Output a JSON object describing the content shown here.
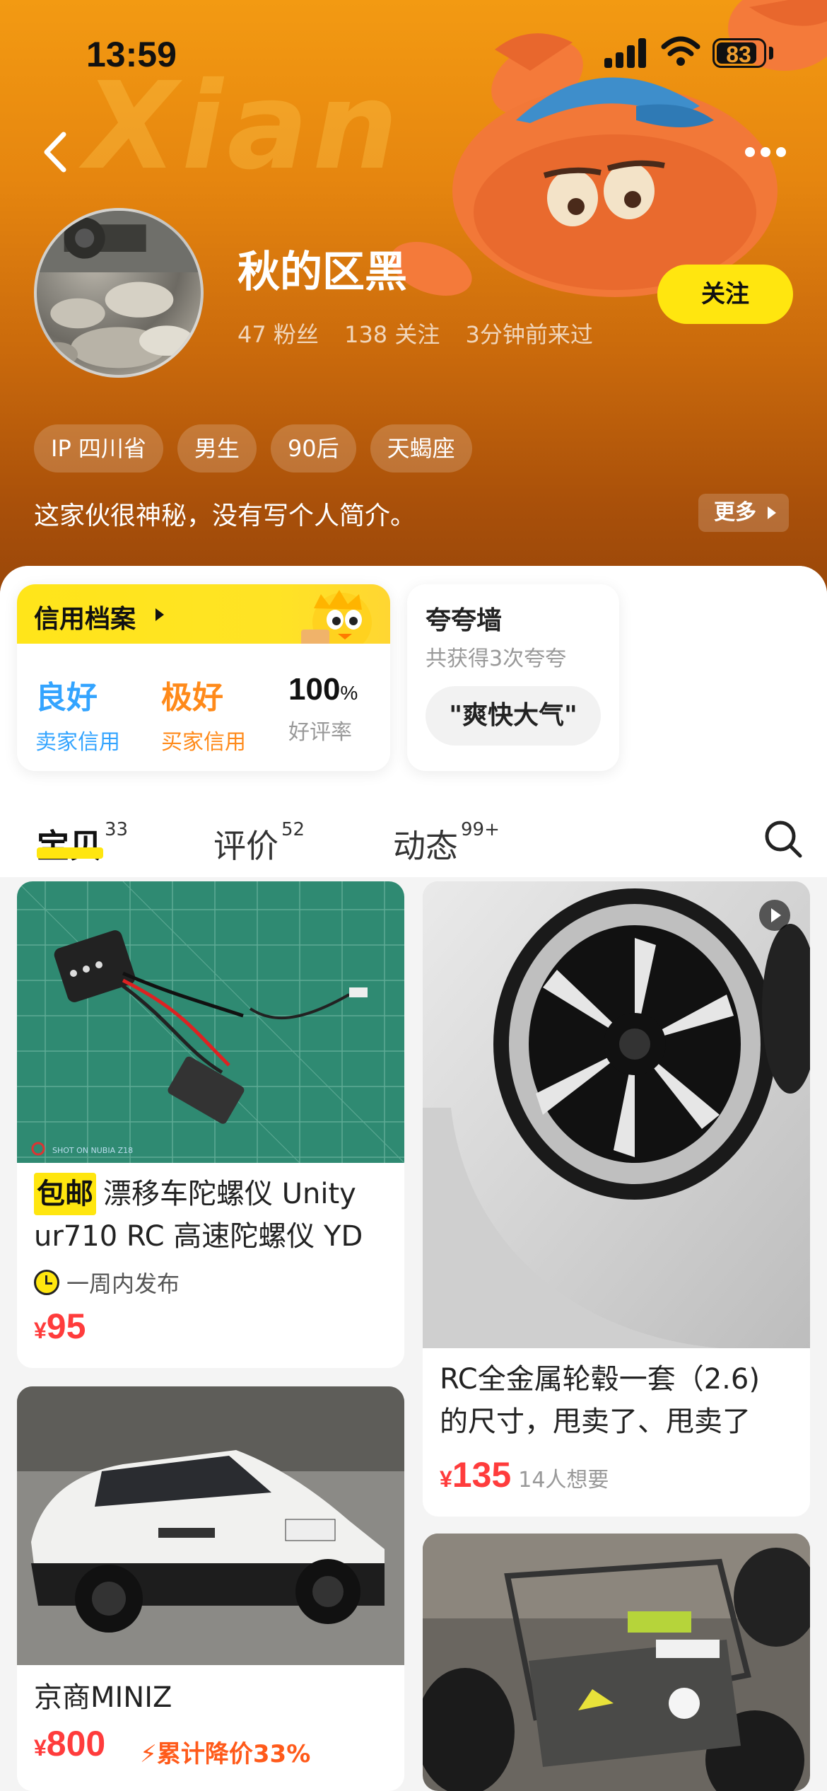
{
  "status_bar": {
    "time": "13:59",
    "battery": "83"
  },
  "header": {
    "bg_word": "Xian",
    "nickname": "秋的区黑",
    "stats": {
      "fans": "47 粉丝",
      "following": "138 关注",
      "last_seen": "3分钟前来过"
    },
    "follow_label": "关注",
    "tags": [
      "IP 四川省",
      "男生",
      "90后",
      "天蝎座"
    ],
    "bio": "这家伙很神秘，没有写个人简介。",
    "more_label": "更多"
  },
  "credit": {
    "title": "信用档案",
    "seller_value": "良好",
    "seller_label": "卖家信用",
    "buyer_value": "极好",
    "buyer_label": "买家信用",
    "rating_value": "100",
    "rating_unit": "%",
    "rating_label": "好评率"
  },
  "praise": {
    "title": "夸夸墙",
    "subtitle": "共获得3次夸夸",
    "pill": "\"爽快大气\""
  },
  "tabs": [
    {
      "label": "宝贝",
      "count": "33"
    },
    {
      "label": "评价",
      "count": "52"
    },
    {
      "label": "动态",
      "count": "99+"
    }
  ],
  "products": [
    {
      "badge": "包邮",
      "title_line1": "漂移车陀螺仪 Unity",
      "title_line2": "ur710 RC 高速陀螺仪 YD",
      "time": "一周内发布",
      "currency": "¥",
      "price": "95",
      "watermark": "SHOT ON NUBIA Z18"
    },
    {
      "title_line1": "RC全金属轮毂一套（2.6)",
      "title_line2": "的尺寸，甩卖了、甩卖了",
      "currency": "¥",
      "price": "135",
      "want": "14人想要"
    },
    {
      "title_line1": "京商MINIZ",
      "currency": "¥",
      "price": "800",
      "price_cut": "累计降价33%"
    },
    {
      "title_line1": ""
    }
  ],
  "colors": {
    "accent_yellow": "#ffe60f",
    "price_red": "#ff3c3c",
    "header_orange": "#e6860f"
  }
}
